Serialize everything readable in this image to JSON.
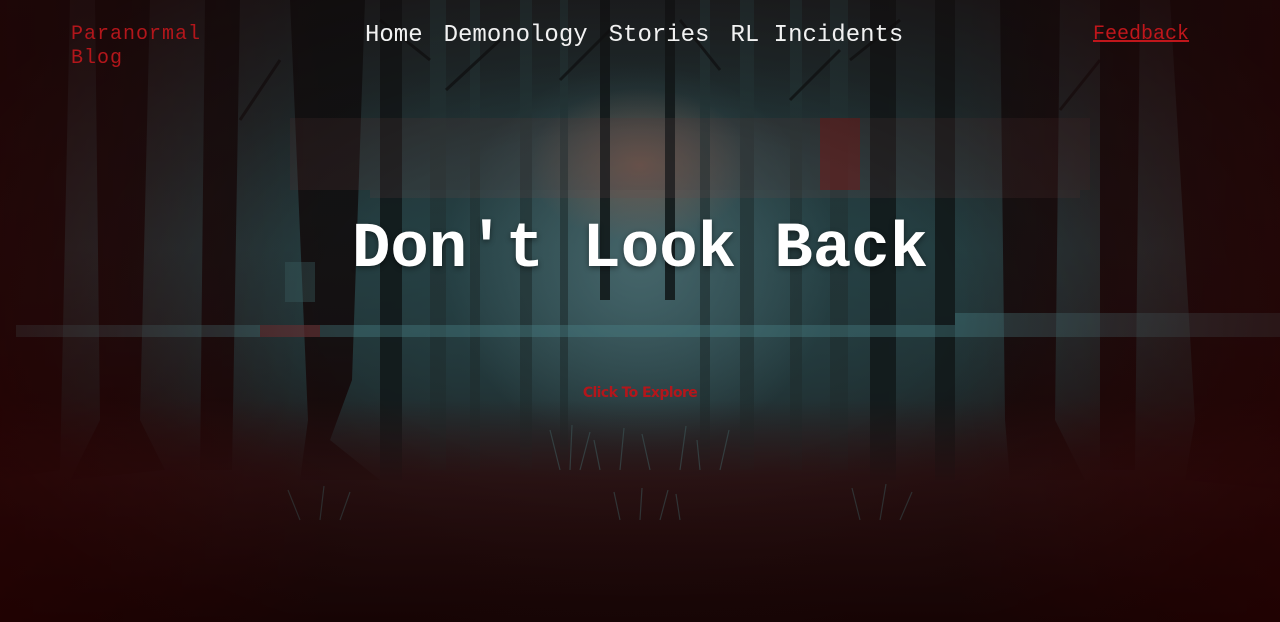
{
  "brand": {
    "title": "Paranormal Blog"
  },
  "nav": {
    "items": [
      {
        "label": "Home"
      },
      {
        "label": "Demonology"
      },
      {
        "label": "Stories"
      },
      {
        "label": "RL Incidents"
      }
    ],
    "feedback_label": "Feedback"
  },
  "hero": {
    "headline": "Don't Look Back",
    "cta_label": "Click To Explore"
  },
  "colors": {
    "accent_red": "#b3161b",
    "nav_text": "#f2f2f2",
    "headline_text": "#ffffff"
  }
}
